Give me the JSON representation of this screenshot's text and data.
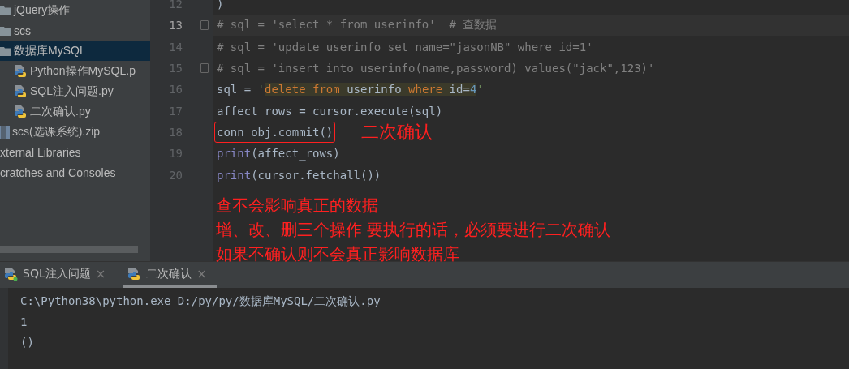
{
  "project_tree": {
    "items": [
      {
        "label": "jQuery操作",
        "kind": "folder",
        "selected": false
      },
      {
        "label": "scs",
        "kind": "folder",
        "selected": false
      },
      {
        "label": "数据库MySQL",
        "kind": "folder",
        "selected": true,
        "children": [
          {
            "label": "Python操作MySQL.p",
            "kind": "python",
            "selected": false
          },
          {
            "label": "SQL注入问题.py",
            "kind": "python",
            "selected": false
          },
          {
            "label": "二次确认.py",
            "kind": "python",
            "selected": false
          }
        ]
      },
      {
        "label": "scs(选课系统).zip",
        "kind": "zip",
        "selected": false
      },
      {
        "label": "xternal Libraries",
        "kind": "plain",
        "selected": false
      },
      {
        "label": "cratches and Consoles",
        "kind": "plain",
        "selected": false
      }
    ]
  },
  "editor": {
    "lines": [
      {
        "number": "12",
        "current": false,
        "fold": false,
        "tokens": [
          {
            "text": ")",
            "kind": "plain"
          }
        ]
      },
      {
        "number": "13",
        "current": true,
        "fold": true,
        "tokens": [
          {
            "text": "# sql = 'select * from userinfo'  # 查数据",
            "kind": "comment"
          }
        ]
      },
      {
        "number": "14",
        "current": false,
        "fold": false,
        "tokens": [
          {
            "text": "# sql = 'update userinfo set name=\"jasonNB\" where id=1'",
            "kind": "comment"
          }
        ]
      },
      {
        "number": "15",
        "current": false,
        "fold": true,
        "tokens": [
          {
            "text": "# sql = 'insert into userinfo(name,password) values(\"jack\",123)'",
            "kind": "comment"
          }
        ]
      },
      {
        "number": "16",
        "current": false,
        "fold": false,
        "tokens": [
          {
            "text": "sql = ",
            "kind": "plain"
          },
          {
            "text": "'",
            "kind": "string"
          },
          {
            "text": "delete from",
            "kind": "sql_keyword"
          },
          {
            "text": " userinfo ",
            "kind": "sql_plain"
          },
          {
            "text": "where",
            "kind": "sql_keyword"
          },
          {
            "text": " id=",
            "kind": "sql_plain"
          },
          {
            "text": "4",
            "kind": "sql_number"
          },
          {
            "text": "'",
            "kind": "string"
          }
        ]
      },
      {
        "number": "17",
        "current": false,
        "fold": false,
        "tokens": [
          {
            "text": "affect_rows = cursor.execute(sql)",
            "kind": "plain"
          }
        ]
      },
      {
        "number": "18",
        "current": false,
        "fold": false,
        "boxed": true,
        "note": "二次确认",
        "tokens": [
          {
            "text": "conn_obj.commit()",
            "kind": "plain"
          }
        ]
      },
      {
        "number": "19",
        "current": false,
        "fold": false,
        "tokens": [
          {
            "text": "print",
            "kind": "builtin"
          },
          {
            "text": "(affect_rows)",
            "kind": "plain"
          }
        ]
      },
      {
        "number": "20",
        "current": false,
        "fold": false,
        "tokens": [
          {
            "text": "print",
            "kind": "builtin"
          },
          {
            "text": "(cursor.fetchall())",
            "kind": "plain"
          }
        ]
      }
    ]
  },
  "annotation": [
    "查不会影响真正的数据",
    "增、改、删三个操作 要执行的话，必须要进行二次确认",
    "如果不确认则不会真正影响数据库"
  ],
  "run_tabs": [
    {
      "label": "SQL注入问题",
      "selected": false,
      "running": true,
      "close": "×"
    },
    {
      "label": "二次确认",
      "selected": true,
      "running": false,
      "close": "×"
    }
  ],
  "console": [
    "C:\\Python38\\python.exe D:/py/py/数据库MySQL/二次确认.py",
    "1",
    "()"
  ]
}
